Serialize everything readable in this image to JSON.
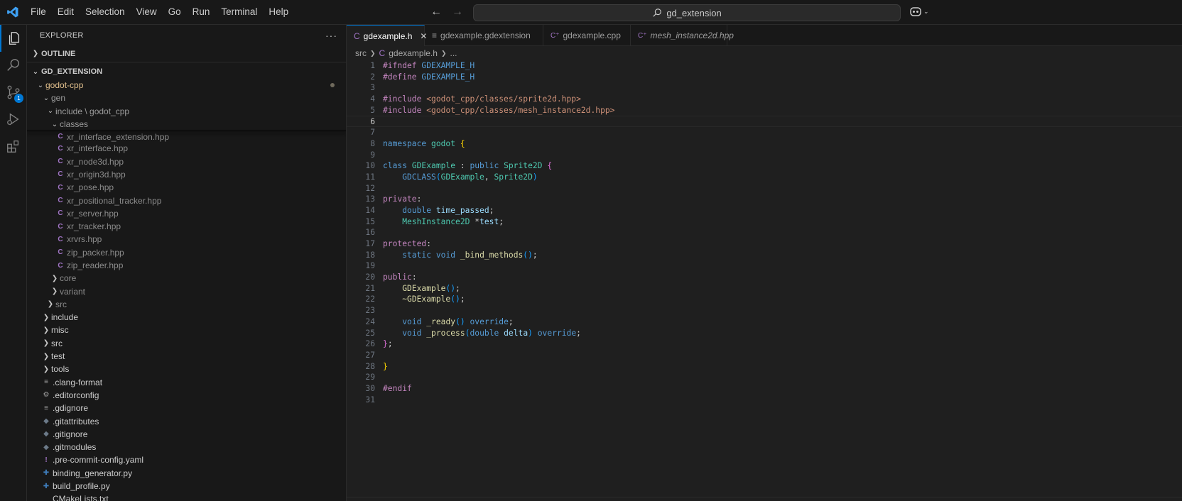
{
  "titlebar": {
    "menu": [
      {
        "label": "File"
      },
      {
        "label": "Edit"
      },
      {
        "label": "Selection"
      },
      {
        "label": "View"
      },
      {
        "label": "Go"
      },
      {
        "label": "Run"
      },
      {
        "label": "Terminal"
      },
      {
        "label": "Help"
      }
    ],
    "search_text": "gd_extension"
  },
  "activity": {
    "scm_badge": "1"
  },
  "sidebar": {
    "title": "EXPLORER",
    "outline_label": "OUTLINE",
    "workspace_label": "GD_EXTENSION",
    "tree": [
      {
        "label": "godot-cpp",
        "icon": "folder",
        "chev": "v"
      },
      {
        "label": "gen",
        "icon": "folder",
        "chev": "v"
      },
      {
        "label": "include \\ godot_cpp",
        "icon": "folder",
        "chev": "v"
      },
      {
        "label": "classes",
        "icon": "folder",
        "chev": "v"
      },
      {
        "label": "xr_interface_extension.hpp"
      },
      {
        "label": "xr_interface.hpp"
      },
      {
        "label": "xr_node3d.hpp"
      },
      {
        "label": "xr_origin3d.hpp"
      },
      {
        "label": "xr_pose.hpp"
      },
      {
        "label": "xr_positional_tracker.hpp"
      },
      {
        "label": "xr_server.hpp"
      },
      {
        "label": "xr_tracker.hpp"
      },
      {
        "label": "xrvrs.hpp"
      },
      {
        "label": "zip_packer.hpp"
      },
      {
        "label": "zip_reader.hpp"
      },
      {
        "label": "core"
      },
      {
        "label": "variant"
      },
      {
        "label": "src"
      },
      {
        "label": "include"
      },
      {
        "label": "misc"
      },
      {
        "label": "src"
      },
      {
        "label": "test"
      },
      {
        "label": "tools"
      },
      {
        "label": ".clang-format"
      },
      {
        "label": ".editorconfig"
      },
      {
        "label": ".gdignore"
      },
      {
        "label": ".gitattributes"
      },
      {
        "label": ".gitignore"
      },
      {
        "label": ".gitmodules"
      },
      {
        "label": ".pre-commit-config.yaml"
      },
      {
        "label": "binding_generator.py"
      },
      {
        "label": "build_profile.py"
      },
      {
        "label": "CMakeLists.txt"
      }
    ]
  },
  "tabs": [
    {
      "label": "gdexample.h",
      "icon": "C"
    },
    {
      "label": "gdexample.gdextension",
      "icon": "lines"
    },
    {
      "label": "gdexample.cpp",
      "icon": "C++"
    },
    {
      "label": "mesh_instance2d.hpp",
      "icon": "C"
    }
  ],
  "breadcrumbs": {
    "folder": "src",
    "file_icon": "C",
    "file": "gdexample.h",
    "more": "..."
  },
  "code": {
    "line_numbers": [
      "1",
      "2",
      "3",
      "4",
      "5",
      "6",
      "7",
      "8",
      "9",
      "10",
      "11",
      "12",
      "13",
      "14",
      "15",
      "16",
      "17",
      "18",
      "19",
      "20",
      "21",
      "22",
      "23",
      "24",
      "25",
      "26",
      "27",
      "28",
      "29",
      "30",
      "31"
    ],
    "lines": [
      "#ifndef GDEXAMPLE_H",
      "#define GDEXAMPLE_H",
      "",
      "#include <godot_cpp/classes/sprite2d.hpp>",
      "#include <godot_cpp/classes/mesh_instance2d.hpp>",
      "",
      "",
      "namespace godot {",
      "",
      "class GDExample : public Sprite2D {",
      "    GDCLASS(GDExample, Sprite2D)",
      "",
      "private:",
      "    double time_passed;",
      "    MeshInstance2D *test;",
      "",
      "protected:",
      "    static void _bind_methods();",
      "",
      "public:",
      "    GDExample();",
      "    ~GDExample();",
      "",
      "    void _ready() override;",
      "    void _process(double delta) override;",
      "};",
      "",
      "}",
      "",
      "#endif",
      ""
    ]
  }
}
